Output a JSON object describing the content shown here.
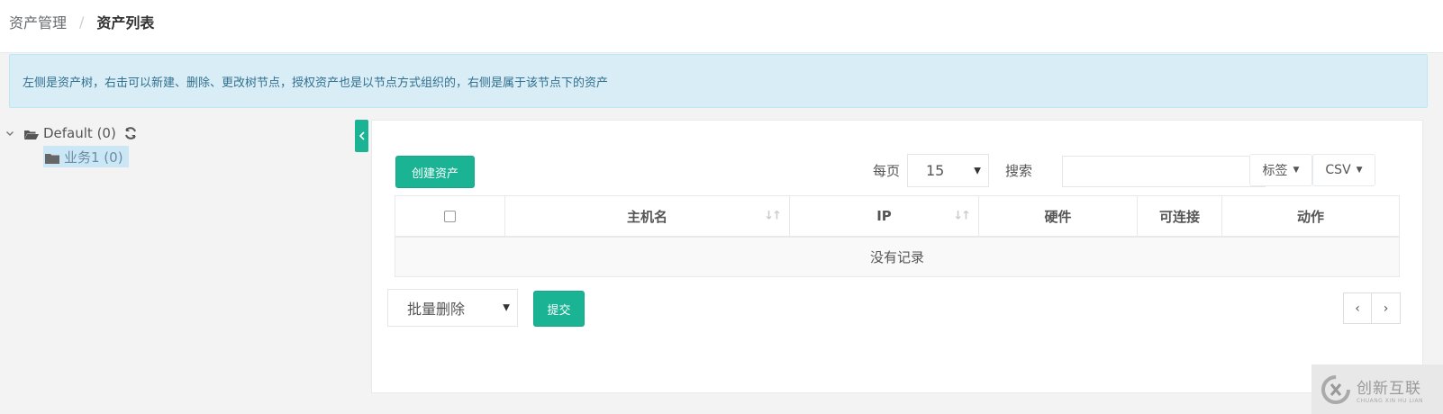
{
  "breadcrumb": {
    "parent": "资产管理",
    "separator": "/",
    "current": "资产列表"
  },
  "alert": {
    "text": "左侧是资产树，右击可以新建、删除、更改树节点，授权资产也是以节点方式组织的，右侧是属于该节点下的资产"
  },
  "tree": {
    "root_label": "Default (0)",
    "children": [
      {
        "label": "业务1 (0)"
      }
    ],
    "icons": {
      "root": "folder-open-icon",
      "child": "folder-icon",
      "refresh": "refresh-icon"
    }
  },
  "toolbar": {
    "create_label": "创建资产",
    "per_page_label": "每页",
    "per_page_value": "15",
    "search_label": "搜索",
    "search_value": "",
    "tags_label": "标签",
    "csv_label": "CSV"
  },
  "table": {
    "columns": [
      "主机名",
      "IP",
      "硬件",
      "可连接",
      "动作"
    ],
    "empty_text": "没有记录"
  },
  "footer": {
    "bulk_action_value": "批量删除",
    "submit_label": "提交",
    "prev_label": "‹",
    "next_label": "›"
  },
  "watermark": {
    "text": "创新互联",
    "subtext": "CHUANG XIN HU LIAN"
  },
  "colors": {
    "accent": "#1ab394",
    "alert_bg": "#d9edf7",
    "alert_text": "#31708f",
    "tree_selected_bg": "#cbe6f5"
  }
}
